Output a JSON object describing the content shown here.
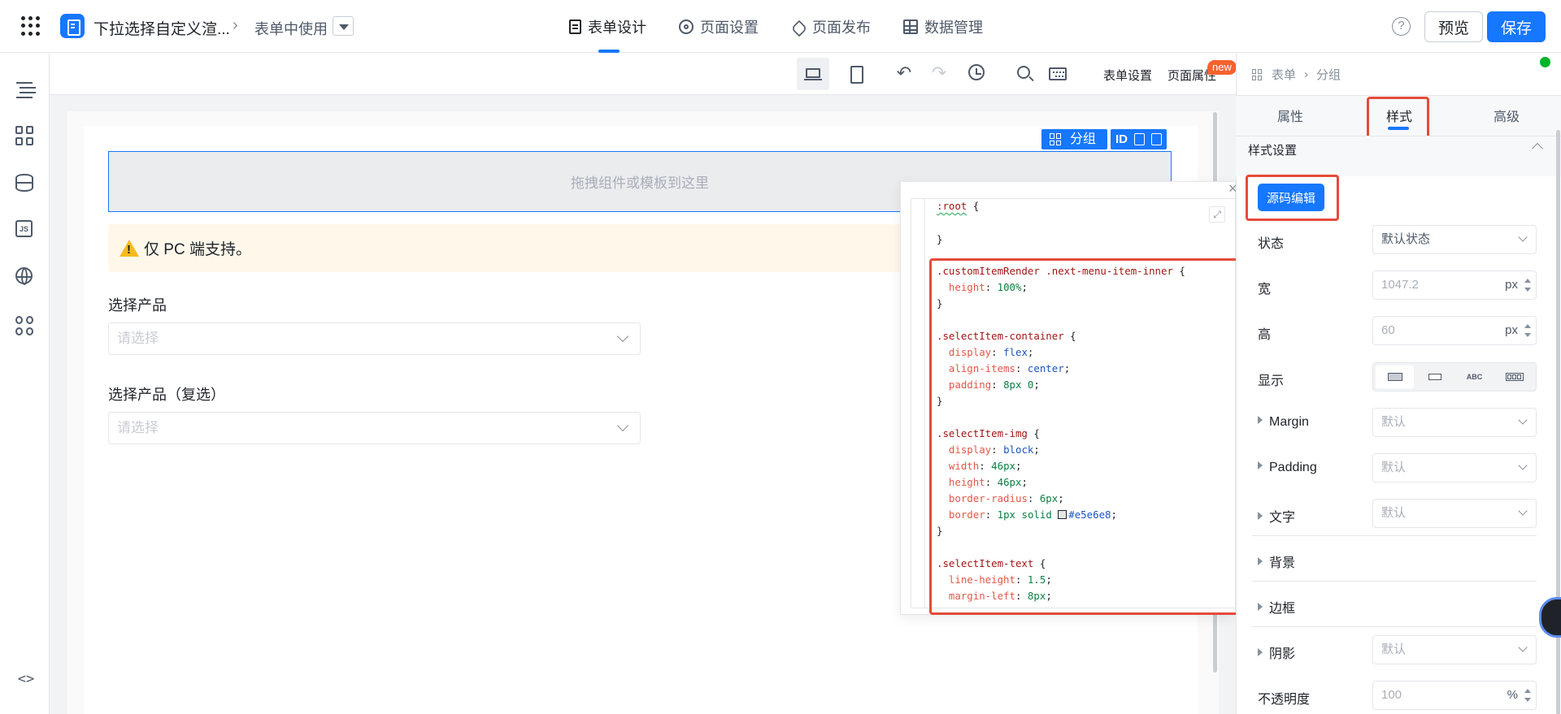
{
  "header": {
    "app_title": "下拉选择自定义渲...",
    "breadcrumb_sub": "表单中使用",
    "tabs": [
      {
        "label": "表单设计",
        "icon": "form-doc-icon",
        "active": true
      },
      {
        "label": "页面设置",
        "icon": "gear-icon",
        "active": false
      },
      {
        "label": "页面发布",
        "icon": "send-icon",
        "active": false
      },
      {
        "label": "数据管理",
        "icon": "table-icon",
        "active": false
      }
    ],
    "help": "?",
    "preview_label": "预览",
    "save_label": "保存",
    "accent_color": "#1677ff"
  },
  "sidebar": {
    "icons": [
      "outline-tree-icon",
      "components-icon",
      "datasource-icon",
      "js-icon",
      "globe-icon",
      "apps-icon",
      "code-icon"
    ],
    "js_label": "JS",
    "code_label": "<>"
  },
  "toolbar": {
    "form_settings": "表单设置",
    "page_props": "页面属性",
    "new_badge": "new"
  },
  "canvas": {
    "group_label": "分组",
    "id_label": "ID",
    "dropzone_text": "拖拽组件或模板到这里",
    "warning_text": "仅 PC 端支持。",
    "fields": [
      {
        "label": "选择产品",
        "placeholder": "请选择"
      },
      {
        "label": "选择产品（复选）",
        "placeholder": "请选择"
      }
    ]
  },
  "code_editor": {
    "close": "×",
    "expand": "⤢",
    "highlight_color": "#e54b3b"
  },
  "right_panel": {
    "breadcrumb": [
      "表单",
      "分组"
    ],
    "tabs": [
      {
        "label": "属性",
        "active": false
      },
      {
        "label": "样式",
        "active": true
      },
      {
        "label": "高级",
        "active": false
      }
    ],
    "section_title": "样式设置",
    "source_edit_label": "源码编辑",
    "props": [
      {
        "label": "状态",
        "value": "默认状态"
      },
      {
        "label": "宽",
        "value": "1047.2",
        "unit": "px"
      },
      {
        "label": "高",
        "value": "60",
        "unit": "px"
      },
      {
        "label": "显示"
      },
      {
        "label": "Margin",
        "value": "默认"
      },
      {
        "label": "Padding",
        "value": "默认"
      },
      {
        "label": "文字",
        "value": "默认"
      },
      {
        "label": "背景"
      },
      {
        "label": "边框"
      },
      {
        "label": "阴影",
        "value": "默认"
      },
      {
        "label": "不透明度",
        "value": "100",
        "unit": "%"
      }
    ],
    "display_options": [
      "ABC",
      "ABC"
    ]
  }
}
